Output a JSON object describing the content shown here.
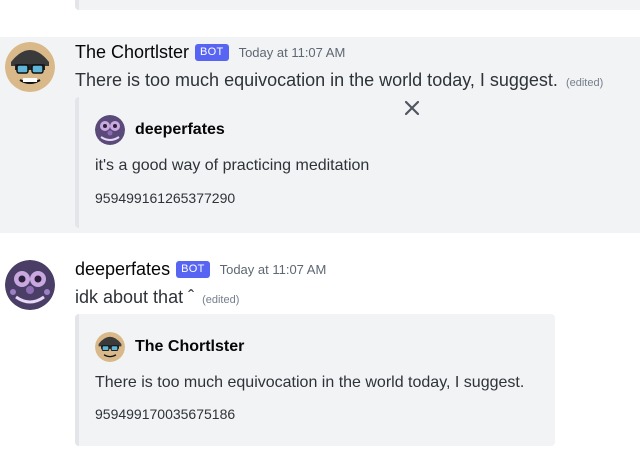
{
  "messages": [
    {
      "username": "The Chortlster",
      "bot_tag": "BOT",
      "timestamp": "Today at 11:07 AM",
      "content": "There is too much equivocation in the world today, I suggest.",
      "edited": "(edited)",
      "avatar_icon": "chortlster-avatar-icon",
      "embed": {
        "author": "deeperfates",
        "description": "it's a good way of practicing meditation",
        "footer": "959499161265377290"
      }
    },
    {
      "username": "deeperfates",
      "bot_tag": "BOT",
      "timestamp": "Today at 11:07 AM",
      "content": "idk about that ˆ",
      "edited": "(edited)",
      "avatar_icon": "deeperfates-avatar-icon",
      "embed": {
        "author": "The Chortlster",
        "description": "There is too much equivocation in the world today, I suggest.",
        "footer": "959499170035675186"
      }
    }
  ],
  "colors": {
    "bot_tag": "#5865f2",
    "highlight": "#f2f3f5",
    "embed_bg": "#f2f3f5",
    "embed_border": "#e3e5e8"
  }
}
